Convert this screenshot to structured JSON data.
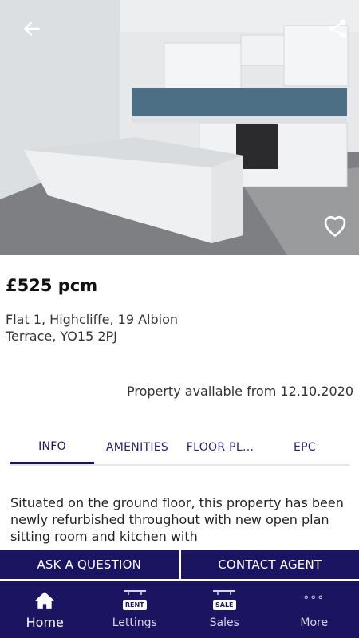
{
  "listing": {
    "price": "£525 pcm",
    "address": "Flat 1, Highcliffe, 19 Albion Terrace, YO15 2PJ",
    "availability": "Property available from 12.10.2020",
    "description": "Situated on the ground floor, this property has been newly refurbished throughout with new open plan sitting room and kitchen with"
  },
  "tabs": [
    {
      "label": "INFO",
      "active": true
    },
    {
      "label": "AMENITIES",
      "active": false
    },
    {
      "label": "FLOOR PL...",
      "active": false
    },
    {
      "label": "EPC",
      "active": false
    }
  ],
  "actions": {
    "ask": "ASK A QUESTION",
    "contact": "CONTACT AGENT"
  },
  "nav": [
    {
      "label": "Home",
      "icon": "home-icon",
      "active": true
    },
    {
      "label": "Lettings",
      "icon": "rent-sign-icon",
      "badge": "RENT"
    },
    {
      "label": "Sales",
      "icon": "sale-sign-icon",
      "badge": "SALE"
    },
    {
      "label": "More",
      "icon": "more-dots-icon"
    }
  ],
  "colors": {
    "brand": "#1b1460",
    "text": "#222222",
    "hero_overlay_icons": "#ffffff"
  }
}
